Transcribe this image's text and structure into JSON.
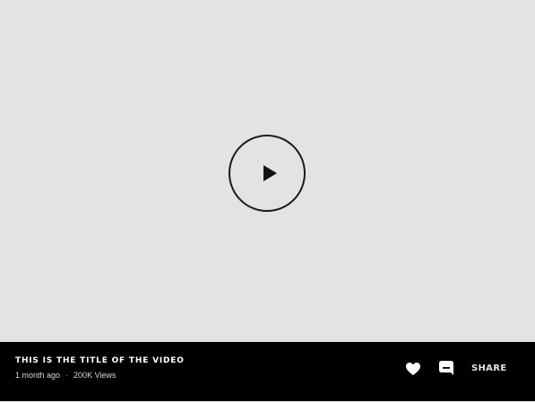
{
  "video": {
    "title": "THIS IS THE TITLE OF THE VIDEO",
    "age": "1 month ago",
    "separator": "·",
    "views": "200K Views"
  },
  "actions": {
    "like_icon": "heart-icon",
    "comment_icon": "comment-icon",
    "share_label": "SHARE"
  },
  "player": {
    "play_icon": "play-icon"
  },
  "colors": {
    "video_background": "#e3e3e3",
    "info_bar_background": "#000000",
    "text_primary": "#ffffff",
    "text_secondary": "#d8d8d8",
    "play_stroke": "#1a1a1a"
  }
}
